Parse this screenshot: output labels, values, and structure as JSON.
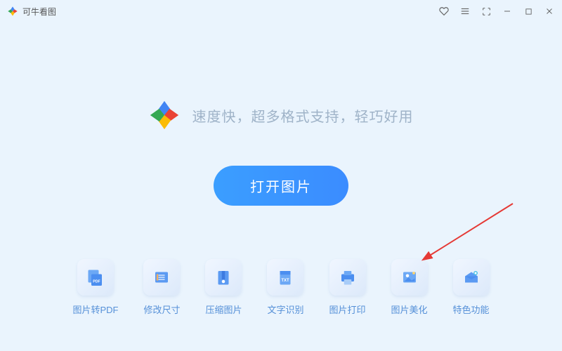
{
  "app": {
    "title": "可牛看图"
  },
  "hero": {
    "tagline": "速度快，超多格式支持，轻巧好用"
  },
  "actions": {
    "open_label": "打开图片"
  },
  "tools": [
    {
      "id": "pdf",
      "label": "图片转PDF"
    },
    {
      "id": "resize",
      "label": "修改尺寸"
    },
    {
      "id": "compress",
      "label": "压缩图片"
    },
    {
      "id": "ocr",
      "label": "文字识别"
    },
    {
      "id": "print",
      "label": "图片打印"
    },
    {
      "id": "beautify",
      "label": "图片美化"
    },
    {
      "id": "special",
      "label": "特色功能"
    }
  ],
  "annotation": {
    "arrow_target": "beautify"
  }
}
